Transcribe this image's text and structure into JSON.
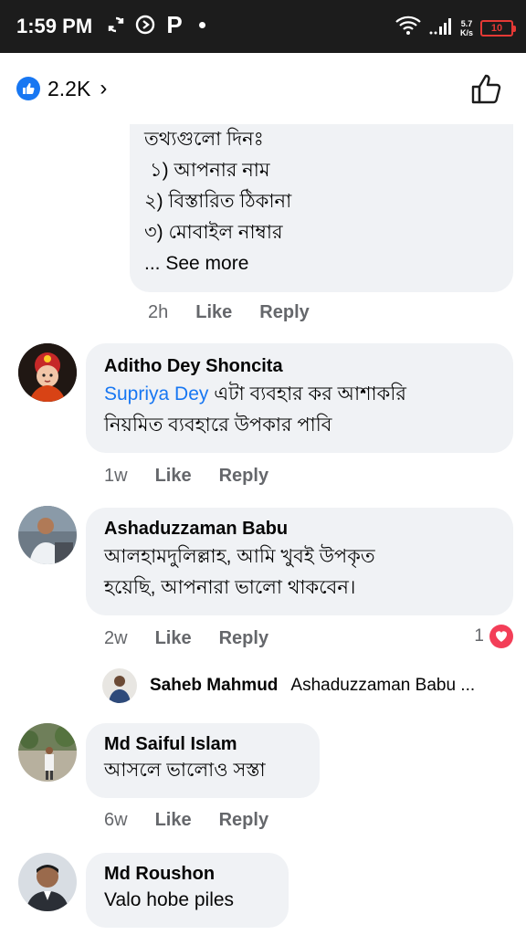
{
  "status_bar": {
    "time": "1:59 PM",
    "net_speed_value": "5.7",
    "net_speed_unit": "K/s",
    "battery": "10",
    "icons": [
      "sync-icon",
      "play-circle-icon",
      "p-icon",
      "dot-icon",
      "wifi-icon",
      "signal-icon",
      "battery-icon"
    ]
  },
  "header": {
    "like_count": "2.2K",
    "chevron": "›",
    "icons": [
      "like-badge-icon",
      "chevron-right-icon",
      "thumbs-up-outline-icon"
    ]
  },
  "comments": [
    {
      "lines": [
        "তথ্যগুলো দিনঃ",
        "১) আপনার নাম",
        "২) বিস্তারিত ঠিকানা",
        "৩) মোবাইল নাম্বার"
      ],
      "see_more": "... See more",
      "time": "2h",
      "like": "Like",
      "reply": "Reply"
    },
    {
      "name": "Aditho Dey Shoncita",
      "mention": "Supriya Dey",
      "text_line1": " এটা ব্যবহার কর আশাকরি",
      "text_line2": "নিয়মিত ব্যবহারে উপকার পাবি",
      "time": "1w",
      "like": "Like",
      "reply": "Reply"
    },
    {
      "name": "Ashaduzzaman Babu",
      "text_line1": "আলহামদুলিল্লাহ, আমি খুবই উপকৃত",
      "text_line2": "হয়েছি, আপনারা ভালো থাকবেন।",
      "time": "2w",
      "like": "Like",
      "reply": "Reply",
      "reaction_count": "1",
      "reply_preview": {
        "name": "Saheb Mahmud",
        "text": "Ashaduzzaman Babu ..."
      }
    },
    {
      "name": "Md Saiful Islam",
      "text": "আসলে ভালোও সস্তা",
      "time": "6w",
      "like": "Like",
      "reply": "Reply"
    },
    {
      "name": "Md Roushon",
      "text": "Valo hobe piles"
    }
  ],
  "colors": {
    "accent": "#1877f2",
    "heart": "#f33e58",
    "bubble": "#f0f2f5",
    "meta": "#65676b"
  }
}
